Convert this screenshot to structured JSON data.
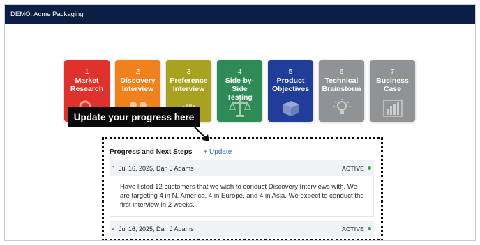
{
  "header": {
    "title": "DEMO: Acme Packaging"
  },
  "stages": [
    {
      "num": "1",
      "name": "Market Research",
      "color": "#e0322c",
      "icon": "magnifier-icon"
    },
    {
      "num": "2",
      "name": "Discovery Interview",
      "color": "#f0821e",
      "icon": "conversation-icon"
    },
    {
      "num": "3",
      "name": "Preference Interview",
      "color": "#a9a221",
      "icon": "hand-icon"
    },
    {
      "num": "4",
      "name": "Side-by-Side Testing",
      "color": "#2e8b57",
      "icon": "balance-scale-icon"
    },
    {
      "num": "5",
      "name": "Product Objectives",
      "color": "#1f3d99",
      "icon": "box-icon"
    },
    {
      "num": "6",
      "name": "Technical Brainstorm",
      "color": "#8f9396",
      "icon": "lightbulb-icon"
    },
    {
      "num": "7",
      "name": "Business Case",
      "color": "#8f9396",
      "icon": "bar-chart-icon"
    }
  ],
  "callout": {
    "text": "Update your progress here"
  },
  "progress": {
    "title": "Progress and Next Steps",
    "update_label": "+ Update",
    "entries": [
      {
        "chevron": "^",
        "date_author": "Jul 16, 2025, Dan J Adams",
        "status": "ACTIVE",
        "body": "Have listed 12 customers that we wish to conduct Discovery Interviews with. We are targeting 4 in N. America, 4 in Europe, and 4 in Asia. We expect to conduct the first interview in 2 weeks."
      },
      {
        "chevron": "v",
        "date_author": "Jul 16, 2025, Dan J Adams",
        "status": "ACTIVE"
      }
    ]
  }
}
